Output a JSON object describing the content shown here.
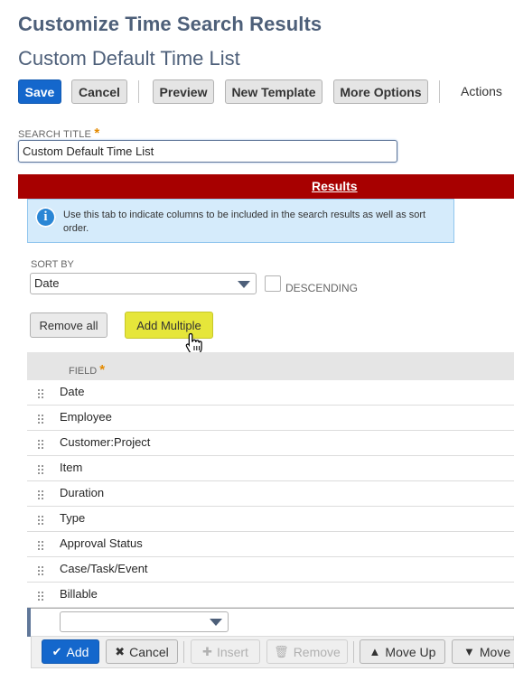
{
  "page": {
    "title": "Customize Time Search Results",
    "search_name": "Custom Default Time List"
  },
  "toolbar": {
    "save": "Save",
    "cancel": "Cancel",
    "preview": "Preview",
    "new_template": "New Template",
    "more_options": "More Options",
    "actions": "Actions"
  },
  "search_title": {
    "label": "SEARCH TITLE",
    "required_mark": "*",
    "value": "Custom Default Time List"
  },
  "tabs": {
    "active": "Results",
    "underline_char": "R",
    "rest": "esults"
  },
  "info": {
    "icon": "info-icon",
    "text": "Use this tab to indicate columns to be included in the search results as well as sort order."
  },
  "sort": {
    "label": "SORT BY",
    "value": "Date",
    "descending_label": "DESCENDING",
    "descending_checked": false
  },
  "buttons": {
    "remove_all": "Remove all",
    "add_multiple": "Add Multiple"
  },
  "grid": {
    "field_header": "FIELD",
    "required_mark": "*",
    "rows": [
      "Date",
      "Employee",
      "Customer:Project",
      "Item",
      "Duration",
      "Type",
      "Approval Status",
      "Case/Task/Event",
      "Billable"
    ],
    "new_row_value": ""
  },
  "row_buttons": {
    "add": "Add",
    "cancel": "Cancel",
    "insert": "Insert",
    "remove": "Remove",
    "move_up": "Move Up",
    "move_down": "Move"
  },
  "colors": {
    "primary": "#1467cc",
    "tab_bar": "#a70000",
    "title": "#4d5f79",
    "highlight": "#e6e63a",
    "info_bg": "#d5ebfb"
  }
}
